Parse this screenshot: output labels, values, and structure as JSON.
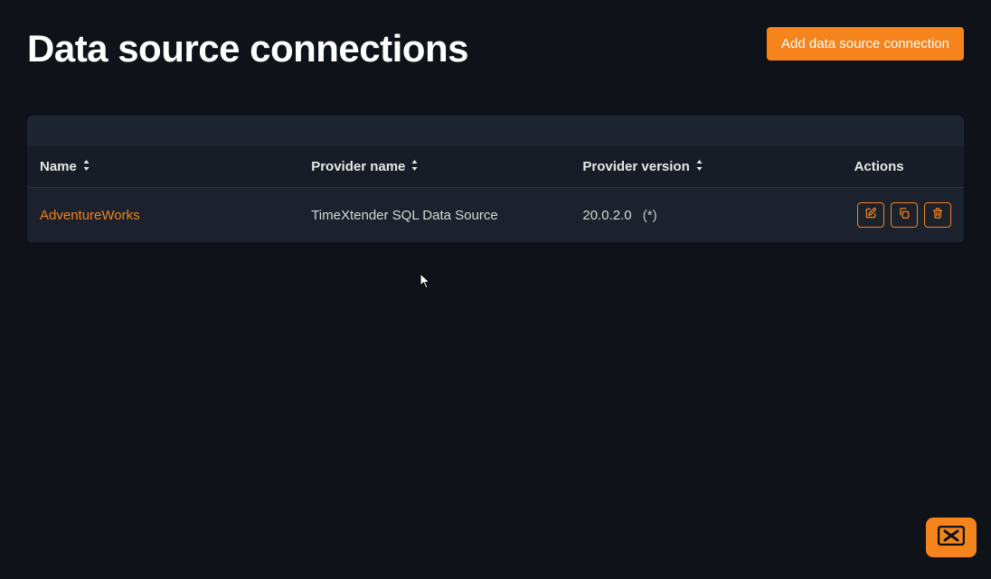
{
  "header": {
    "title": "Data source connections",
    "add_button": "Add data source connection"
  },
  "table": {
    "columns": {
      "name": "Name",
      "provider_name": "Provider name",
      "provider_version": "Provider version",
      "actions": "Actions"
    },
    "rows": [
      {
        "name": "AdventureWorks",
        "provider_name": "TimeXtender SQL Data Source",
        "provider_version": "20.0.2.0",
        "version_suffix": "(*)"
      }
    ]
  }
}
